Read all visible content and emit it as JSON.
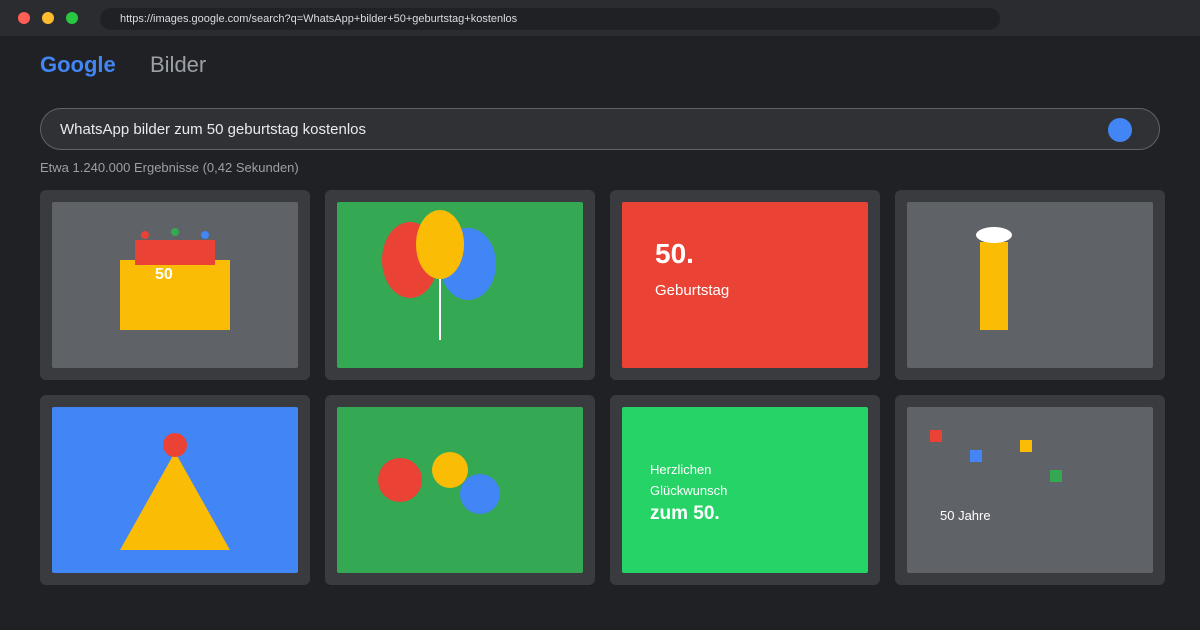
{
  "browser": {
    "url": "https://images.google.com/search?q=WhatsApp+bilder+50+geburtstag+kostenlos"
  },
  "header": {
    "logo": "Google",
    "section": "Bilder"
  },
  "search": {
    "query": "WhatsApp bilder zum 50 geburtstag kostenlos",
    "result_stats": "Etwa 1.240.000 Ergebnisse (0,42 Sekunden)"
  },
  "results": [
    {
      "text": "50"
    },
    {},
    {
      "title": "50.",
      "subtitle": "Geburtstag"
    },
    {},
    {},
    {},
    {
      "line1": "Herzlichen",
      "line2": "Glückwunsch",
      "line3": "zum 50."
    },
    {
      "label": "50 Jahre"
    }
  ],
  "colors": {
    "background": "#202124",
    "card": "#3a3b3e",
    "google_blue": "#4285f4",
    "google_red": "#ea4335",
    "google_yellow": "#fbbc05",
    "google_green": "#34a853",
    "bright_green": "#25d366",
    "thumb_gray": "#5f6368"
  }
}
